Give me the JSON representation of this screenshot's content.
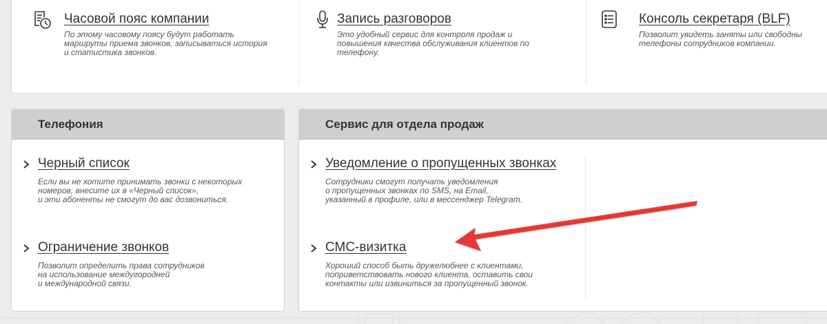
{
  "features": [
    {
      "icon": "timezone-clock-icon",
      "title": "Часовой пояс компании",
      "description": [
        "По этому часовому поясу будут работать",
        "маршруты приема звонков, записываться история",
        "и статистика звонков."
      ]
    },
    {
      "icon": "microphone-icon",
      "title": "Запись разговоров",
      "description": [
        "Это удобный сервис для контроля продаж и",
        "повышения качества обслуживания клиентов по",
        "телефону."
      ]
    },
    {
      "icon": "list-console-icon",
      "title": "Консоль секретаря (BLF)",
      "description": [
        "Позволит увидеть заняты или свободны",
        "телефоны сотрудников компании."
      ]
    }
  ],
  "telephony": {
    "header": "Телефония",
    "items": [
      {
        "title": "Черный список",
        "description": [
          "Если вы не хотите принимать звонки с некоторых",
          "номеров, внесите их в «Черный список»,",
          "и эти абоненты не смогут до вас дозвониться."
        ]
      },
      {
        "title": "Ограничение звонков",
        "description": [
          "Позволит определить права сотрудников",
          "на использование междугородней",
          "и международной связи."
        ]
      }
    ]
  },
  "sales": {
    "header": "Сервис для отдела продаж",
    "items": [
      {
        "title": "Уведомление о пропущенных звонках",
        "description": [
          "Сотрудники смогут получать уведомления",
          "о пропущенных звонках по SMS, на Email,",
          "указанный в профиле, или в мессенджер Telegram."
        ]
      },
      {
        "title": "СМС-визитка",
        "description": [
          "Хороший способ быть дружелюбнее с клиентами,",
          "поприветствовать нового клиента, оставить свои",
          "контакты или извиниться за пропущенный звонок."
        ]
      }
    ]
  },
  "colors": {
    "background": "#ececec",
    "panel_header": "#cfcfcf",
    "annotation_arrow": "#e53935"
  }
}
